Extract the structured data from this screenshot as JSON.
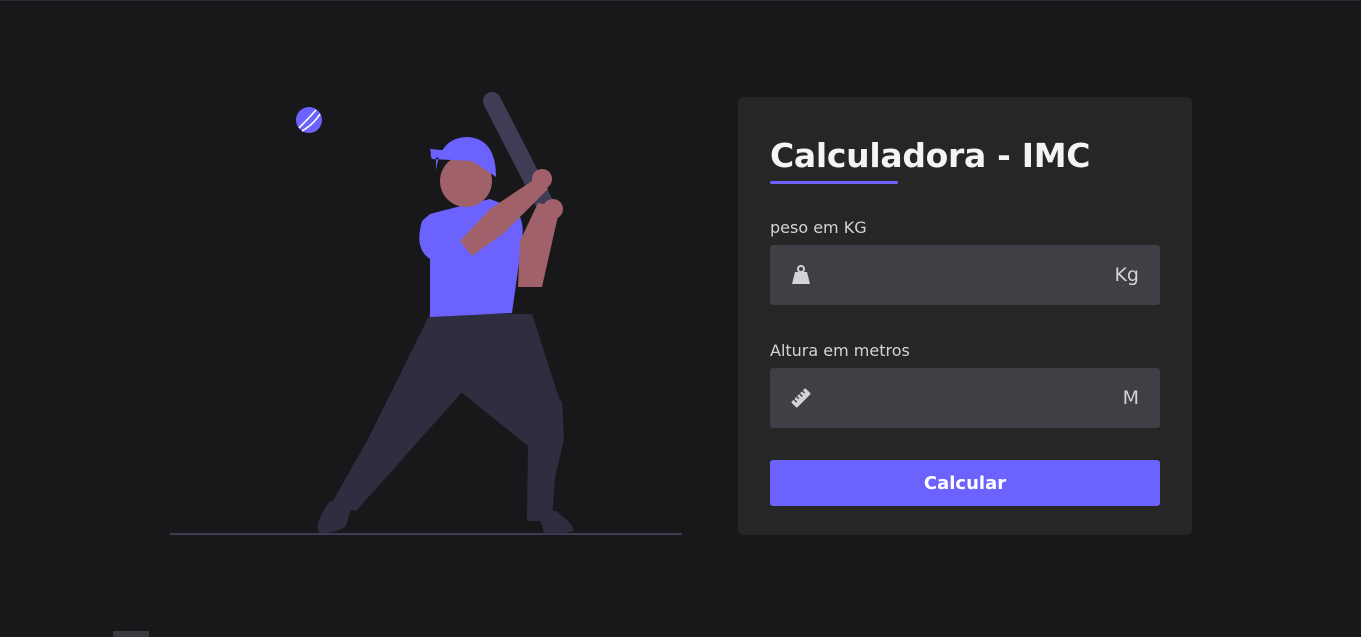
{
  "form": {
    "title": "Calculadora - IMC",
    "weight": {
      "label": "peso em KG",
      "value": "",
      "unit": "Kg",
      "icon": "weight-icon"
    },
    "height": {
      "label": "Altura em metros",
      "value": "",
      "unit": "M",
      "icon": "ruler-icon"
    },
    "submit_label": "Calcular"
  },
  "illustration": {
    "subject": "baseball-player"
  },
  "colors": {
    "background": "#18181b",
    "card": "#262626",
    "input": "#3f3f46",
    "accent": "#6c63ff",
    "text": "#f4f4f5"
  }
}
